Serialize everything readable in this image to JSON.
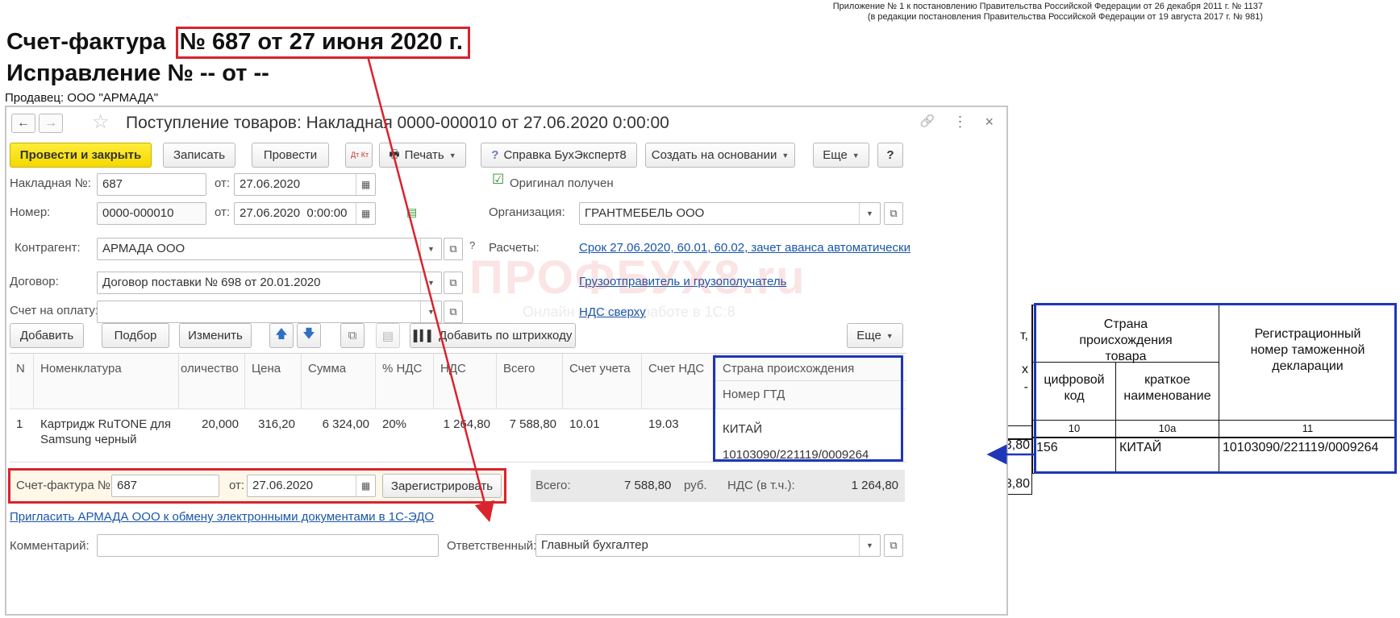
{
  "annex": {
    "line1": "Приложение № 1 к постановлению Правительства Российской Федерации от 26 декабря 2011 г. № 1137",
    "line2": "(в редакции постановления Правительства Российской Федерации от 19 августа 2017 г. № 981)"
  },
  "doc": {
    "title_prefix": "Счет-фактура",
    "title_highlight": "№ 687 от 27 июня 2020 г.",
    "correction": "Исправление № -- от --",
    "seller": "Продавец: ООО \"АРМАДА\""
  },
  "window": {
    "title": "Поступление товаров: Накладная 0000-000010 от 27.06.2020 0:00:00",
    "back": "←",
    "forward": "→",
    "star": "☆",
    "link_icon": "🔗",
    "menu_icon": "⋮",
    "close_icon": "×"
  },
  "toolbar": {
    "post_close": "Провести и закрыть",
    "save": "Записать",
    "post": "Провести",
    "dtkt": "Дт Кт",
    "print": "Печать",
    "help": "Справка БухЭксперт8",
    "create_based": "Создать на основании",
    "more": "Еще",
    "question": "?"
  },
  "form": {
    "waybill_label": "Накладная №:",
    "waybill_value": "687",
    "from1_label": "от:",
    "from1_value": "27.06.2020",
    "original_label": "Оригинал получен",
    "number_label": "Номер:",
    "number_value": "0000-000010",
    "from2_label": "от:",
    "from2_value": "27.06.2020  0:00:00",
    "org_label": "Организация:",
    "org_value": "ГРАНТМЕБЕЛЬ ООО",
    "counterparty_label": "Контрагент:",
    "counterparty_value": "АРМАДА ООО",
    "question": "?",
    "settlements_label": "Расчеты:",
    "settlements_link": "Срок 27.06.2020, 60.01, 60.02, зачет аванса автоматически",
    "contract_label": "Договор:",
    "contract_value": "Договор поставки № 698 от 20.01.2020",
    "shipper_link": "Грузоотправитель и грузополучатель",
    "invoice_pay_label": "Счет на оплату:",
    "invoice_pay_value": "",
    "vat_link": "НДС сверху"
  },
  "watermark": {
    "main": "ПРОФБУХ8.ru",
    "sub": "Онлайн курсы по работе в 1С:8"
  },
  "table_toolbar": {
    "add": "Добавить",
    "pick": "Подбор",
    "change": "Изменить",
    "barcode": "Добавить по штрихкоду",
    "more": "Еще"
  },
  "table": {
    "headers": {
      "n": "N",
      "item": "Номенклатура",
      "qty": "оличество",
      "price": "Цена",
      "sum": "Сумма",
      "vat_pct": "% НДС",
      "vat": "НДС",
      "total": "Всего",
      "account": "Счет учета",
      "vat_account": "Счет НДС",
      "country": "Страна происхождения",
      "gtd": "Номер ГТД"
    },
    "row": {
      "n": "1",
      "item": "Картридж RuTONE для Samsung черный",
      "qty": "20,000",
      "price": "316,20",
      "sum": "6 324,00",
      "vat_pct": "20%",
      "vat": "1 264,80",
      "total": "7 588,80",
      "account": "10.01",
      "vat_account": "19.03",
      "country": "КИТАЙ",
      "gtd": "10103090/221119/0009264"
    }
  },
  "invoice": {
    "label": "Счет-фактура №:",
    "number": "687",
    "from_label": "от:",
    "date": "27.06.2020",
    "register": "Зарегистрировать"
  },
  "totals": {
    "total_label": "Всего:",
    "total_value": "7 588,80",
    "currency": "руб.",
    "vat_label": "НДС (в т.ч.):",
    "vat_value": "1 264,80"
  },
  "edo_link": "Пригласить АРМАДА ООО к обмену электронными документами в 1С-ЭДО",
  "comment_label": "Комментарий:",
  "comment_value": "",
  "responsible_label": "Ответственный:",
  "responsible_value": "Главный бухгалтер",
  "printed": {
    "partial_t": "т,",
    "partial_kh": "х",
    "partial_dash": "-",
    "partial_80a": "3,80",
    "partial_80b": "3,80",
    "country_header": "Страна происхождения товара",
    "code_header": "цифровой код",
    "short_name_header": "краткое наименование",
    "reg_header": "Регистрационный номер таможенной декларации",
    "col10": "10",
    "col10a": "10а",
    "col11": "11",
    "code": "156",
    "short_name": "КИТАЙ",
    "reg_number": "10103090/221119/0009264"
  }
}
